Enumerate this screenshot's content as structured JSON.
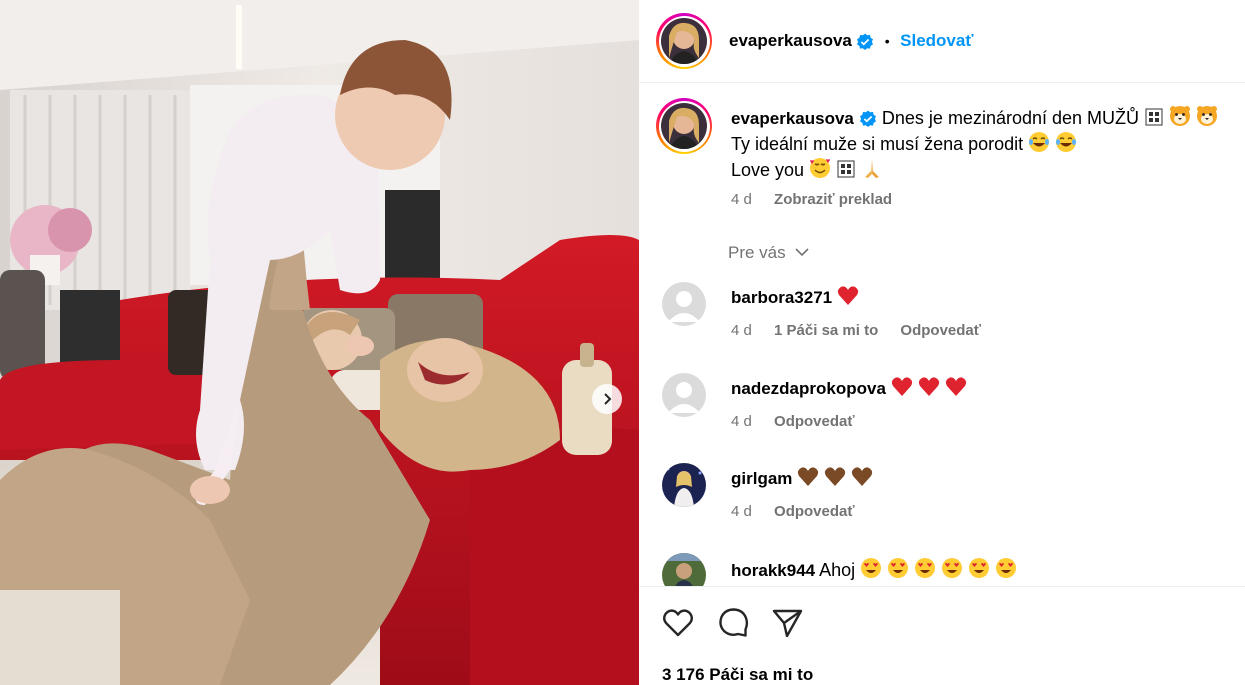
{
  "post": {
    "author": "evaperkausova",
    "follow_label": "Sledovať",
    "separator": "•"
  },
  "caption": {
    "author": "evaperkausova",
    "line1": "Dnes je mezinárodní den MUŽŮ",
    "line2": "Ty ideální muže si musí žena porodit",
    "line3": "Love you",
    "time": "4 d",
    "translate_label": "Zobraziť preklad"
  },
  "for_you_label": "Pre vás",
  "comments": [
    {
      "user": "barbora3271",
      "text": "",
      "time": "4 d",
      "likes": "1 Páči sa mi to",
      "reply": "Odpovedať"
    },
    {
      "user": "nadezdaprokopova",
      "text": "",
      "time": "4 d",
      "reply": "Odpovedať"
    },
    {
      "user": "girlgam",
      "text": "",
      "time": "4 d",
      "reply": "Odpovedať"
    },
    {
      "user": "horakk944",
      "text": "Ahoj"
    }
  ],
  "likes_count": "3 176 Páči sa mi to",
  "icons": [
    "verified-icon",
    "heart-icon",
    "comment-icon",
    "share-icon",
    "chevron-down-icon",
    "chevron-right-icon"
  ],
  "colors": {
    "link": "#0095f6",
    "muted": "#737373",
    "verified": "#0095f6",
    "divider": "#efefef"
  }
}
